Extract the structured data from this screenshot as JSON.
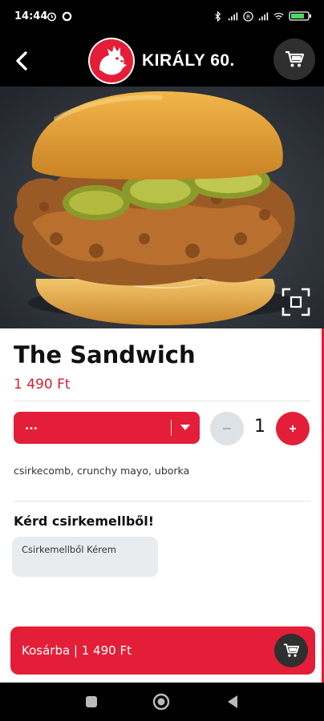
{
  "status_bar": {
    "time": "14:44"
  },
  "header": {
    "brand_name": "KIRÁLY 60."
  },
  "product": {
    "title": "The Sandwich",
    "price": "1 490 Ft",
    "variant_selected": "...",
    "quantity": "1",
    "ingredients": "csirkecomb, crunchy mayo, uborka"
  },
  "options": {
    "section_title": "Kérd csirkemellből!",
    "choice_label": "Csirkemellből Kérem"
  },
  "cart_bar": {
    "label": "Kosárba | 1 490 Ft"
  },
  "colors": {
    "brand_red": "#e41e38",
    "dark": "#2f2f2f",
    "price_red": "#d9202f"
  },
  "icons": [
    "back-arrow-icon",
    "brand-logo",
    "cart-icon",
    "fullscreen-icon",
    "chevron-down-icon",
    "minus-icon",
    "plus-icon",
    "nav-recent-icon",
    "nav-home-icon",
    "nav-back-icon"
  ]
}
